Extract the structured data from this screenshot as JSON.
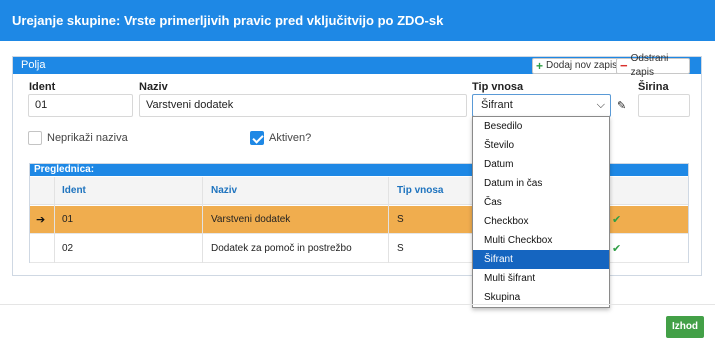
{
  "window": {
    "title": "Urejanje skupine: Vrste primerljivih pravic pred vključitvijo po ZDO-sk"
  },
  "panel": {
    "title": "Polja",
    "add_label": "Dodaj nov zapis",
    "remove_label": "Odstrani zapis"
  },
  "form": {
    "ident_label": "Ident",
    "ident_value": "01",
    "naziv_label": "Naziv",
    "naziv_value": "Varstveni dodatek",
    "tip_label": "Tip vnosa",
    "tip_value": "Šifrant",
    "sirina_label": "Širina",
    "sirina_value": "",
    "neprikazi_label": "Neprikaži naziva",
    "neprikazi_checked": false,
    "aktiven_label": "Aktiven?",
    "aktiven_checked": true
  },
  "preglednica": {
    "title": "Preglednica:",
    "columns": [
      "Ident",
      "Naziv",
      "Tip vnosa"
    ],
    "rows": [
      {
        "ident": "01",
        "naziv": "Varstveni dodatek",
        "tip": "S",
        "selected": true,
        "active": true
      },
      {
        "ident": "02",
        "naziv": "Dodatek za pomoč in postrežbo",
        "tip": "S",
        "selected": false,
        "active": true
      }
    ]
  },
  "dropdown": {
    "options": [
      "Besedilo",
      "Število",
      "Datum",
      "Datum in čas",
      "Čas",
      "Checkbox",
      "Multi Checkbox",
      "Šifrant",
      "Multi šifrant",
      "Skupina"
    ],
    "selected_index": 7
  },
  "footer": {
    "exit_label": "Izhod"
  },
  "icons": {
    "add": "plus-icon",
    "remove": "minus-icon",
    "select": "chevron-down-icon",
    "edit": "pencil-icon",
    "row_pointer": "arrow-right-icon",
    "row_status": "check-icon"
  },
  "colors": {
    "accent": "#1e88e5",
    "selected_row": "#f0ad4e",
    "exit_button": "#43a047",
    "dropdown_active": "#1565c0"
  }
}
